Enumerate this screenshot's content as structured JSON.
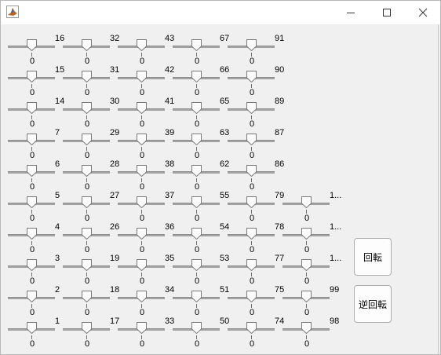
{
  "window": {
    "app_icon": "matlab-icon",
    "controls": [
      "minimize-icon",
      "maximize-icon",
      "close-icon"
    ]
  },
  "slider_value": "0",
  "columns": [
    [
      "16",
      "15",
      "14",
      "7",
      "6",
      "5",
      "4",
      "3",
      "2",
      "1"
    ],
    [
      "32",
      "31",
      "30",
      "29",
      "28",
      "27",
      "26",
      "19",
      "18",
      "17"
    ],
    [
      "43",
      "42",
      "41",
      "39",
      "38",
      "37",
      "36",
      "35",
      "34",
      "33"
    ],
    [
      "67",
      "66",
      "65",
      "63",
      "62",
      "55",
      "54",
      "53",
      "51",
      "50"
    ],
    [
      "91",
      "90",
      "89",
      "87",
      "86",
      "79",
      "78",
      "77",
      "75",
      "74"
    ],
    [
      "1...",
      "1...",
      "1...",
      "99",
      "98"
    ]
  ],
  "buttons": {
    "rotate": "回転",
    "reverse_rotate": "逆回転"
  }
}
